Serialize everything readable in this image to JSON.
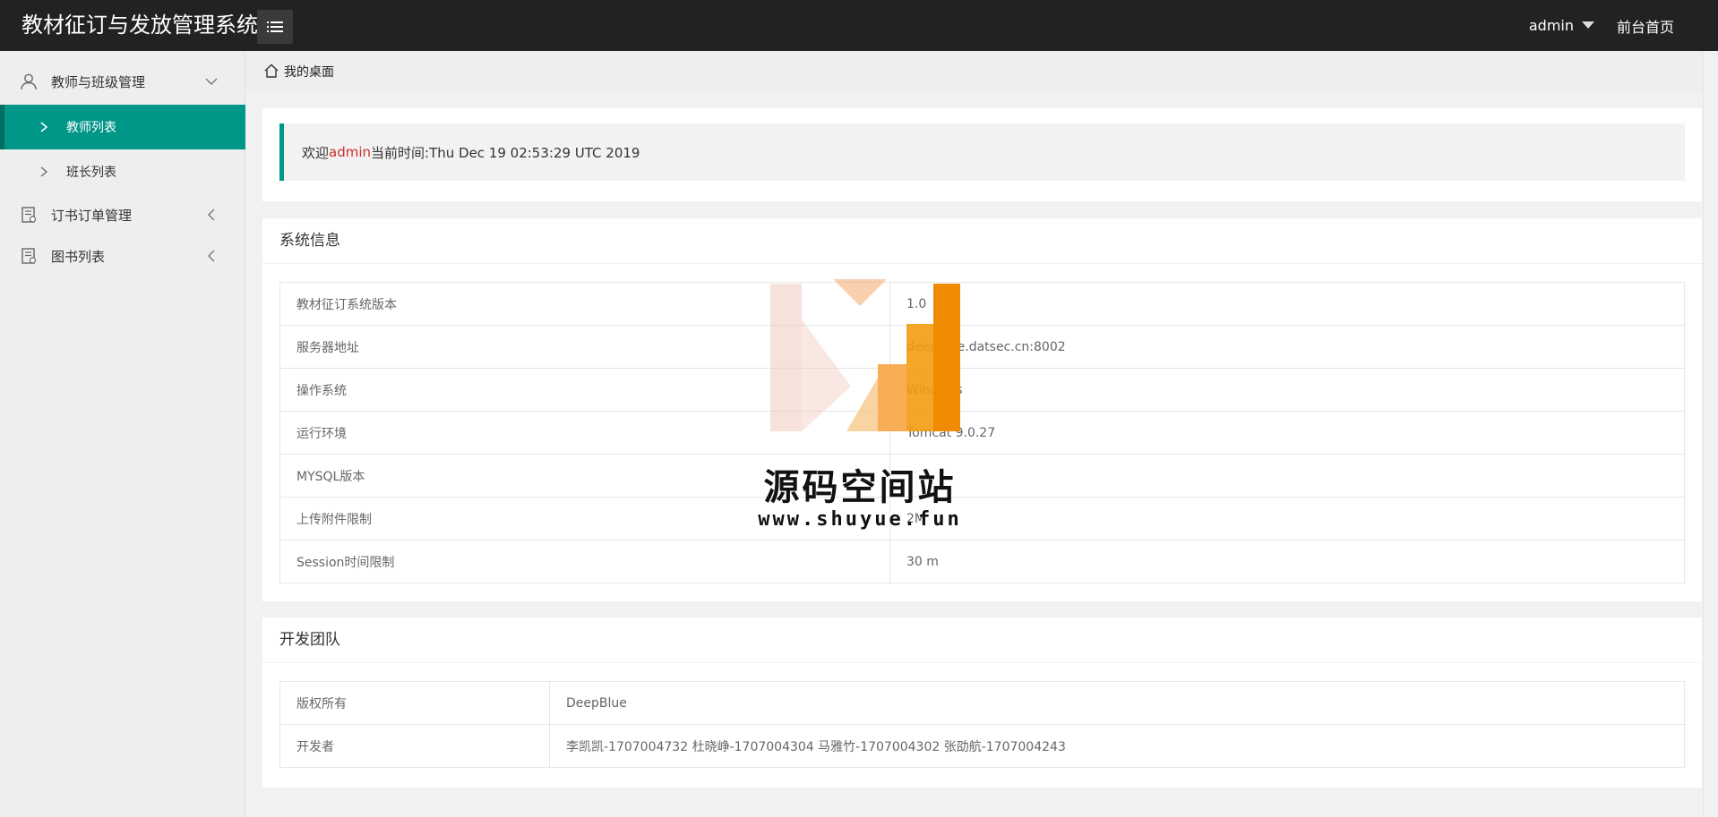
{
  "header": {
    "app_title": "教材征订与发放管理系统",
    "user_label": "admin",
    "front_link": "前台首页"
  },
  "sidebar": {
    "groups": [
      {
        "label": "教师与班级管理",
        "icon": "user-icon",
        "expanded": true
      },
      {
        "label": "订书订单管理",
        "icon": "document-icon",
        "expanded": false
      },
      {
        "label": "图书列表",
        "icon": "document-icon",
        "expanded": false
      }
    ],
    "subitems": [
      {
        "label": "教师列表",
        "active": true
      },
      {
        "label": "班长列表",
        "active": false
      }
    ]
  },
  "breadcrumb": {
    "label": "我的桌面"
  },
  "welcome": {
    "prefix": "欢迎 ",
    "user": "admin",
    "time_text": "当前时间:Thu Dec 19 02:53:29 UTC 2019"
  },
  "sysinfo": {
    "title": "系统信息",
    "rows": [
      {
        "key": "教材征订系统版本",
        "value": "1.0"
      },
      {
        "key": "服务器地址",
        "value": "deepblue.datsec.cn:8002"
      },
      {
        "key": "操作系统",
        "value": "Windows"
      },
      {
        "key": "运行环境",
        "value": "Tomcat 9.0.27"
      },
      {
        "key": "MYSQL版本",
        "value": ""
      },
      {
        "key": "上传附件限制",
        "value": "2M"
      },
      {
        "key": "Session时间限制",
        "value": "30 m"
      }
    ]
  },
  "team": {
    "title": "开发团队",
    "rows": [
      {
        "key": "版权所有",
        "value": "DeepBlue"
      },
      {
        "key": "开发者",
        "value": "李凯凯-1707004732 杜晓峥-1707004304 马雅竹-1707004302 张劭航-1707004243"
      }
    ]
  },
  "watermark": {
    "title": "源码空间站",
    "url": "www.shuyue.fun"
  },
  "colors": {
    "header_bg": "#222222",
    "accent": "#009688",
    "user_highlight": "#c9302c",
    "watermark_orange": "#f39c12"
  }
}
